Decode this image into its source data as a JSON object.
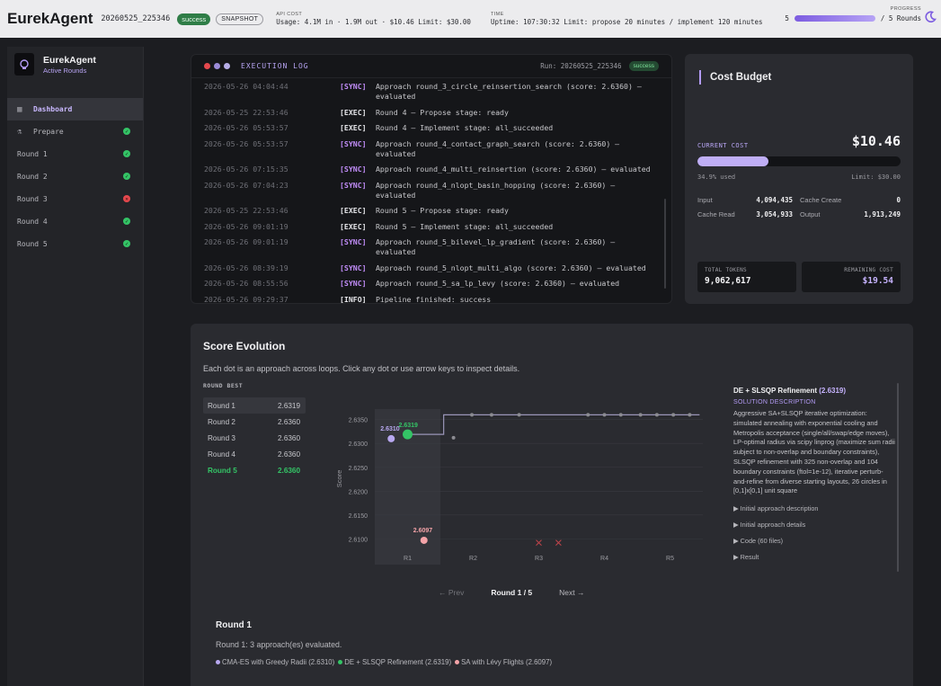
{
  "topbar": {
    "brand": "EurekAgent",
    "run_id": "20260525_225346",
    "status": "success",
    "snapshot": "SNAPSHOT",
    "api_cost_label": "API COST",
    "api_cost_value": "Usage: 4.1M in · 1.9M out · $10.46 Limit: $30.00",
    "time_label": "TIME",
    "time_value": "Uptime: 107:30:32 Limit: propose 20 minutes / implement 120 minutes",
    "progress_label": "PROGRESS",
    "progress_current": "5",
    "progress_total": "/ 5 Rounds",
    "progress_fraction": 1.0,
    "theme_icon": "moon-icon"
  },
  "sidebar": {
    "title": "EurekAgent",
    "subtitle": "Active Rounds",
    "items": [
      {
        "label": "Dashboard",
        "icon": "grid-icon",
        "active": true,
        "status": null
      },
      {
        "label": "Prepare",
        "icon": "flask-icon",
        "active": false,
        "status": "ok"
      },
      {
        "label": "Round 1",
        "active": false,
        "status": "ok"
      },
      {
        "label": "Round 2",
        "active": false,
        "status": "ok"
      },
      {
        "label": "Round 3",
        "active": false,
        "status": "fail"
      },
      {
        "label": "Round 4",
        "active": false,
        "status": "ok"
      },
      {
        "label": "Round 5",
        "active": false,
        "status": "ok"
      }
    ]
  },
  "log": {
    "title": "EXECUTION LOG",
    "run": "Run: 20260525_225346",
    "status": "success",
    "lines": [
      {
        "ts": "2026-05-26 04:04:44",
        "tag": "[SYNC]",
        "msg": "Approach round_3_circle_reinsertion_search (score: 2.6360) — evaluated"
      },
      {
        "ts": "2026-05-25 22:53:46",
        "tag": "[EXEC]",
        "msg": "Round 4 — Propose stage: ready"
      },
      {
        "ts": "2026-05-26 05:53:57",
        "tag": "[EXEC]",
        "msg": "Round 4 — Implement stage: all_succeeded"
      },
      {
        "ts": "2026-05-26 05:53:57",
        "tag": "[SYNC]",
        "msg": "Approach round_4_contact_graph_search (score: 2.6360) — evaluated"
      },
      {
        "ts": "2026-05-26 07:15:35",
        "tag": "[SYNC]",
        "msg": "Approach round_4_multi_reinsertion (score: 2.6360) — evaluated"
      },
      {
        "ts": "2026-05-26 07:04:23",
        "tag": "[SYNC]",
        "msg": "Approach round_4_nlopt_basin_hopping (score: 2.6360) — evaluated"
      },
      {
        "ts": "2026-05-25 22:53:46",
        "tag": "[EXEC]",
        "msg": "Round 5 — Propose stage: ready"
      },
      {
        "ts": "2026-05-26 09:01:19",
        "tag": "[EXEC]",
        "msg": "Round 5 — Implement stage: all_succeeded"
      },
      {
        "ts": "2026-05-26 09:01:19",
        "tag": "[SYNC]",
        "msg": "Approach round_5_bilevel_lp_gradient (score: 2.6360) — evaluated"
      },
      {
        "ts": "2026-05-26 08:39:19",
        "tag": "[SYNC]",
        "msg": "Approach round_5_nlopt_multi_algo (score: 2.6360) — evaluated"
      },
      {
        "ts": "2026-05-26 08:55:56",
        "tag": "[SYNC]",
        "msg": "Approach round_5_sa_lp_levy (score: 2.6360) — evaluated"
      },
      {
        "ts": "2026-05-26 09:29:37",
        "tag": "[INFO]",
        "msg": "Pipeline finished: success"
      }
    ]
  },
  "cost": {
    "title": "Cost Budget",
    "current_label": "CURRENT COST",
    "current_value": "$10.46",
    "used_fraction": 0.349,
    "used_text": "34.9% used",
    "limit_text": "Limit: $30.00",
    "input_label": "Input",
    "input_value": "4,094,435",
    "cache_create_label": "Cache Create",
    "cache_create_value": "0",
    "cache_read_label": "Cache Read",
    "cache_read_value": "3,054,933",
    "output_label": "Output",
    "output_value": "1,913,249",
    "total_tokens_label": "TOTAL TOKENS",
    "total_tokens_value": "9,062,617",
    "remaining_label": "REMAINING COST",
    "remaining_value": "$19.54"
  },
  "score": {
    "title": "Score Evolution",
    "description": "Each dot is an approach across loops. Click any dot or use arrow keys to inspect details.",
    "round_best_label": "ROUND BEST",
    "round_best": [
      {
        "round": "Round 1",
        "score": "2.6319",
        "selected": true,
        "best": false
      },
      {
        "round": "Round 2",
        "score": "2.6360",
        "selected": false,
        "best": false
      },
      {
        "round": "Round 3",
        "score": "2.6360",
        "selected": false,
        "best": false
      },
      {
        "round": "Round 4",
        "score": "2.6360",
        "selected": false,
        "best": false
      },
      {
        "round": "Round 5",
        "score": "2.6360",
        "selected": false,
        "best": true
      }
    ],
    "pager": {
      "prev": "← Prev",
      "current": "Round 1 / 5",
      "next": "Next →"
    },
    "round_detail": {
      "title": "Round 1",
      "summary": "Round 1: 3 approach(es) evaluated.",
      "approaches": [
        {
          "label": "CMA-ES with Greedy Radii (2.6310)",
          "color": "#b8a8f0"
        },
        {
          "label": "DE + SLSQP Refinement (2.6319)",
          "color": "#34c466"
        },
        {
          "label": "SA with Lévy Flights (2.6097)",
          "color": "#f4a3a8"
        }
      ]
    },
    "detail": {
      "title": "DE + SLSQP Refinement",
      "title_score": "(2.6319)",
      "section": "SOLUTION DESCRIPTION",
      "body": "Aggressive SA+SLSQP iterative optimization: simulated annealing with exponential cooling and Metropolis acceptance (single/all/swap/edge moves), LP-optimal radius via scipy linprog (maximize sum radii subject to non-overlap and boundary constraints), SLSQP refinement with 325 non-overlap and 104 boundary constraints (ftol=1e-12), iterative perturb-and-refine from diverse starting layouts, 26 circles in [0,1]x[0,1] unit square",
      "expanders": [
        "▶ Initial approach description",
        "▶ Initial approach details",
        "▶ Code (60 files)",
        "▶ Result"
      ]
    }
  },
  "chart_data": {
    "type": "scatter",
    "xlabel": "",
    "ylabel": "Score",
    "x_categories": [
      "R1",
      "R2",
      "R3",
      "R4",
      "R5"
    ],
    "y_ticks": [
      "2.6350",
      "2.6300",
      "2.6250",
      "2.6200",
      "2.6150",
      "2.6100"
    ],
    "ylim": [
      2.608,
      2.6372
    ],
    "highlighted_round": "R1",
    "best_so_far": [
      {
        "x": 0.0,
        "y": 2.631
      },
      {
        "x": 0.0,
        "y": 2.6319
      },
      {
        "x": 0.55,
        "y": 2.6319
      },
      {
        "x": 0.55,
        "y": 2.636
      },
      {
        "x": 4.45,
        "y": 2.636
      }
    ],
    "points": [
      {
        "round": "R1",
        "x": -0.25,
        "y": 2.631,
        "label": "2.6310",
        "color": "#b8a8f0",
        "kind": "ok"
      },
      {
        "round": "R1",
        "x": 0.0,
        "y": 2.6319,
        "label": "2.6319",
        "color": "#34c466",
        "kind": "selected"
      },
      {
        "round": "R1",
        "x": 0.25,
        "y": 2.6097,
        "label": "2.6097",
        "color": "#f4a3a8",
        "kind": "ok"
      },
      {
        "round": "R2",
        "x": 0.7,
        "y": 2.6312,
        "label": "",
        "color": "#8c8c92",
        "kind": "ok"
      },
      {
        "round": "R2",
        "x": 0.98,
        "y": 2.636,
        "label": "",
        "color": "#8c8c92",
        "kind": "ok"
      },
      {
        "round": "R2",
        "x": 1.28,
        "y": 2.636,
        "label": "",
        "color": "#8c8c92",
        "kind": "ok"
      },
      {
        "round": "R3",
        "x": 1.7,
        "y": 2.636,
        "label": "",
        "color": "#8c8c92",
        "kind": "ok"
      },
      {
        "round": "R3",
        "x": 2.0,
        "y": 2.6092,
        "label": "",
        "color": "#c0444a",
        "kind": "fail"
      },
      {
        "round": "R3",
        "x": 2.3,
        "y": 2.6092,
        "label": "",
        "color": "#c0444a",
        "kind": "fail"
      },
      {
        "round": "R4",
        "x": 2.75,
        "y": 2.636,
        "label": "",
        "color": "#8c8c92",
        "kind": "ok"
      },
      {
        "round": "R4",
        "x": 3.0,
        "y": 2.636,
        "label": "",
        "color": "#8c8c92",
        "kind": "ok"
      },
      {
        "round": "R4",
        "x": 3.25,
        "y": 2.636,
        "label": "",
        "color": "#8c8c92",
        "kind": "ok"
      },
      {
        "round": "R5",
        "x": 3.55,
        "y": 2.636,
        "label": "",
        "color": "#8c8c92",
        "kind": "ok"
      },
      {
        "round": "R5",
        "x": 3.8,
        "y": 2.636,
        "label": "",
        "color": "#8c8c92",
        "kind": "ok"
      },
      {
        "round": "R5",
        "x": 4.05,
        "y": 2.636,
        "label": "",
        "color": "#8c8c92",
        "kind": "ok"
      },
      {
        "round": "R5",
        "x": 4.3,
        "y": 2.636,
        "label": "",
        "color": "#8c8c92",
        "kind": "ok"
      }
    ],
    "grid": true
  }
}
